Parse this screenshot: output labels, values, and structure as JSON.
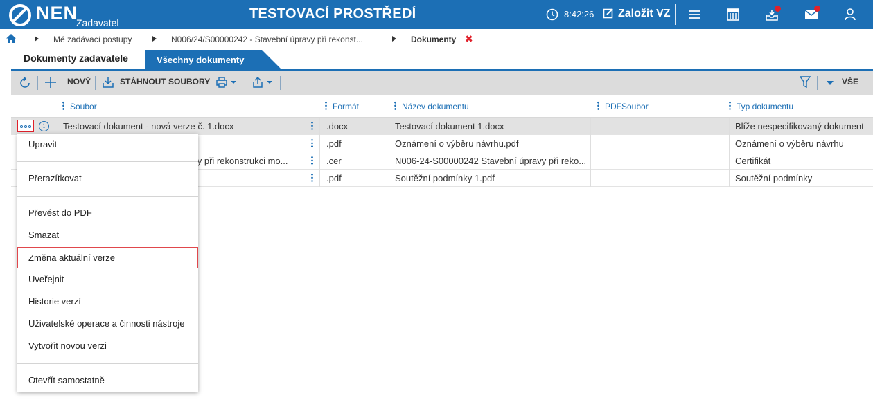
{
  "header": {
    "logo_text": "NEN",
    "logo_sub": "Zadavatel",
    "env_title": "TESTOVACÍ PROSTŘEDÍ",
    "time": "8:42:26",
    "create_label": "Založit VZ",
    "accent": "#1c6fb5",
    "notify_color": "#e0212b",
    "icons": [
      "clock-icon",
      "edit-icon",
      "menu-icon",
      "calculator-icon",
      "inbox-icon",
      "mail-icon",
      "user-icon"
    ]
  },
  "breadcrumb": {
    "items": [
      "Mé zadávací postupy",
      "N006/24/S00000242 - Stavební úpravy při rekonst...",
      "Dokumenty"
    ],
    "close_glyph": "✖"
  },
  "tabs": [
    "Dokumenty zadavatele",
    "Všechny dokumenty"
  ],
  "toolbar": {
    "new_label": "NOVÝ",
    "download_label": "STÁHNOUT SOUBORY",
    "filter_label": "VŠE"
  },
  "table": {
    "columns": [
      "Soubor",
      "Formát",
      "Název dokumentu",
      "PDFSoubor",
      "Typ dokumentu"
    ],
    "rows": [
      {
        "soubor": "Testovací dokument - nová verze č. 1.docx",
        "format": ".docx",
        "nazev": "Testovací dokument 1.docx",
        "pdf": "",
        "typ": "Blíže nespecifikovaný dokument"
      },
      {
        "soubor": "",
        "format": ".pdf",
        "nazev": "Oznámení o výběru návrhu.pdf",
        "pdf": "",
        "typ": "Oznámení o výběru návrhu"
      },
      {
        "soubor": "avy při rekonstrukci mo...",
        "format": ".cer",
        "nazev": "N006-24-S00000242 Stavební úpravy při reko...",
        "pdf": "",
        "typ": "Certifikát"
      },
      {
        "soubor": "",
        "format": ".pdf",
        "nazev": "Soutěžní podmínky 1.pdf",
        "pdf": "",
        "typ": "Soutěžní podmínky"
      }
    ]
  },
  "context_menu": {
    "items": [
      "Upravit",
      "Přerazítkovat",
      "Převést do PDF",
      "Smazat",
      "Změna aktuální verze",
      "Uveřejnit",
      "Historie verzí",
      "Uživatelské operace a činnosti nástroje",
      "Vytvořit novou verzi",
      "Otevřít samostatně"
    ],
    "highlighted": "Změna aktuální verze"
  }
}
